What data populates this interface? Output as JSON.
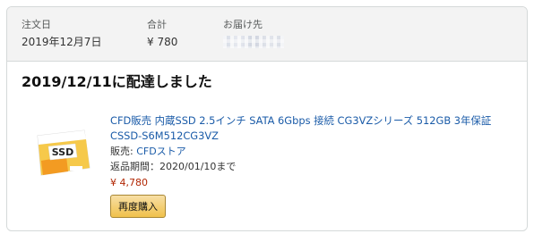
{
  "order_summary": {
    "order_date_label": "注文日",
    "order_date_value": "2019年12月7日",
    "total_label": "合計",
    "total_value": "¥ 780",
    "ship_to_label": "お届け先"
  },
  "shipment": {
    "status": "2019/12/11に配達しました"
  },
  "item": {
    "title": "CFD販売 内蔵SSD 2.5インチ SATA 6Gbps 接続 CG3VZシリーズ 512GB 3年保証 CSSD-S6M512CG3VZ",
    "seller_label": "販売: ",
    "seller_name": "CFDストア",
    "return_period": "返品期間：2020/01/10まで",
    "price": "¥ 4,780",
    "image_badge_text": "SSD",
    "buy_again_label": "再度購入"
  },
  "colors": {
    "link": "#1a5ba8",
    "price": "#b12704",
    "button": "#f0c14b"
  }
}
